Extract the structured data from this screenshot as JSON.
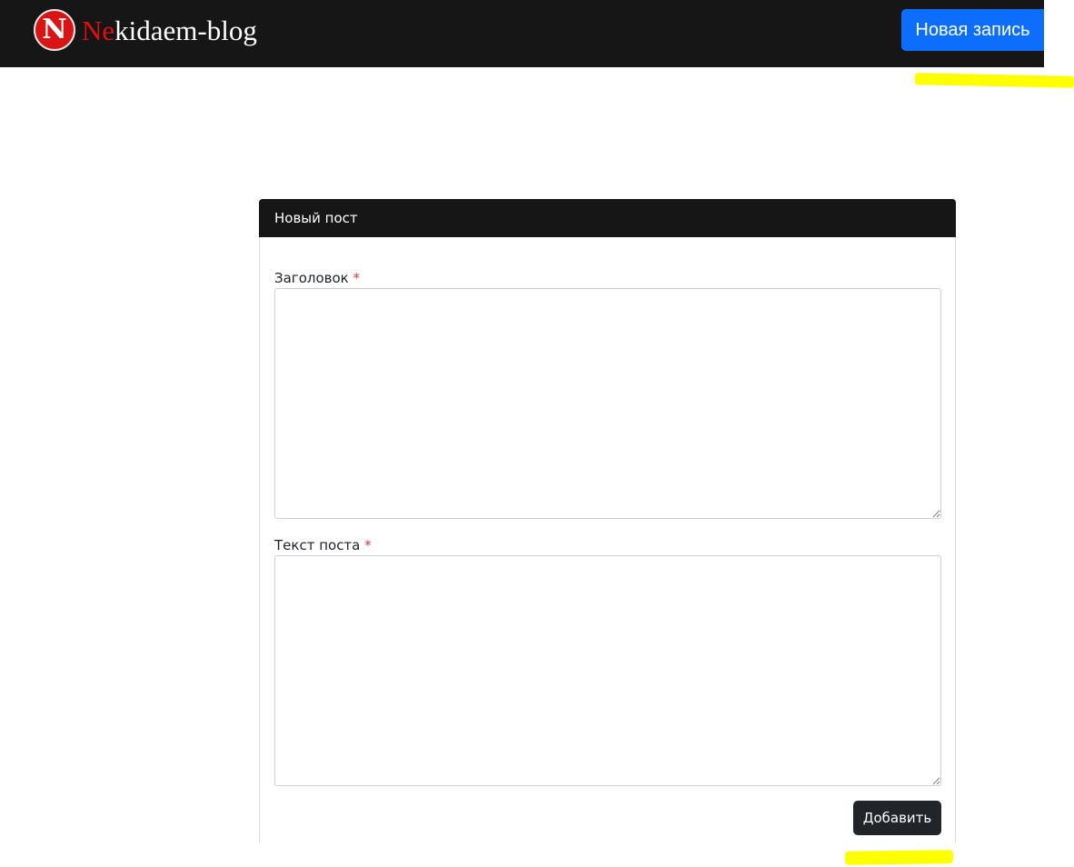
{
  "header": {
    "logo_letter": "N",
    "brand_accent": "Ne",
    "brand_rest": "kidaem-blog",
    "new_post_button": "Новая запись"
  },
  "form": {
    "card_title": "Новый пост",
    "title_label": "Заголовок",
    "body_label": "Текст поста",
    "required_marker": "*",
    "title_value": "",
    "body_value": "",
    "submit_button": "Добавить"
  },
  "colors": {
    "navbar": "#161616",
    "primary": "#0d6efd",
    "brand_red": "#e10f0f",
    "dark_button": "#212529",
    "required": "#dc3545",
    "highlight": "#ffff00"
  }
}
